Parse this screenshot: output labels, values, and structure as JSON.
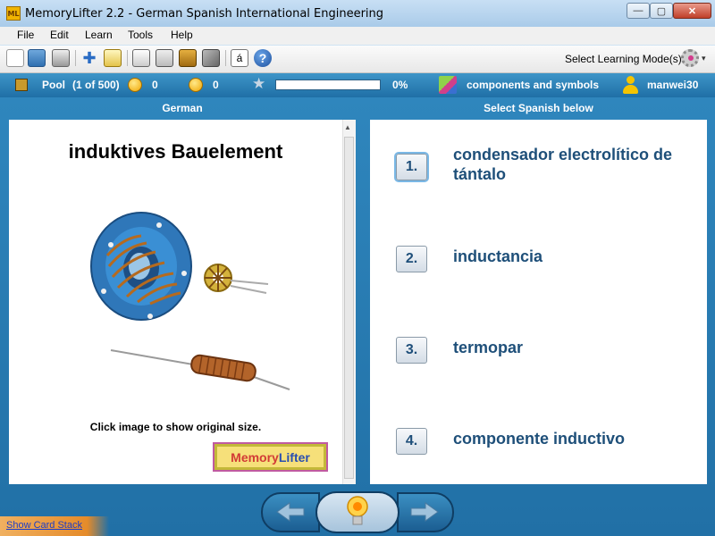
{
  "window": {
    "app_icon_text": "ML",
    "title": "MemoryLifter 2.2 - German Spanish International Engineering",
    "close_glyph": "✕",
    "max_glyph": "▢",
    "min_glyph": "—"
  },
  "menu": [
    "File",
    "Edit",
    "Learn",
    "Tools",
    "Help"
  ],
  "toolbar": {
    "icons": [
      "new-icon",
      "open-icon",
      "print-icon",
      "add-icon",
      "edit-icon",
      "presentation-icon",
      "print-cards-icon",
      "card-box-icon",
      "tools-icon",
      "special-char-icon",
      "help-icon"
    ],
    "special_char_glyph": "á",
    "help_glyph": "?",
    "add_glyph": "✚",
    "learning_mode_label": "Select Learning Mode(s)",
    "caret": "▾"
  },
  "status": {
    "pool_label": "Pool",
    "pool_count": "(1 of 500)",
    "correct_count": "0",
    "wrong_count": "0",
    "progress_percent": 0,
    "progress_label": "0%",
    "chapter": "components and symbols",
    "user": "manwei30"
  },
  "columns": {
    "question_header": "German",
    "answer_header": "Select Spanish below"
  },
  "question": {
    "word": "induktives Bauelement",
    "image_hint": "Click image to show original size.",
    "logo_text_a": "Memory",
    "logo_text_b": "Lifter"
  },
  "answers": [
    {
      "number": "1.",
      "text": "condensador electrolítico de tántalo"
    },
    {
      "number": "2.",
      "text": "inductancia"
    },
    {
      "number": "3.",
      "text": "termopar"
    },
    {
      "number": "4.",
      "text": "componente inductivo"
    }
  ],
  "bottom": {
    "show_card_stack": "Show Card Stack"
  },
  "colors": {
    "accent": "#2274ab",
    "answer_text": "#1e4f79",
    "status_bar": "#2a80b8"
  }
}
